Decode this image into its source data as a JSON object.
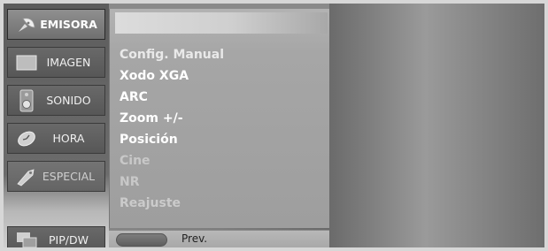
{
  "sidebar": {
    "items": [
      {
        "label": "EMISORA",
        "icon": "satellite-dish-icon"
      },
      {
        "label": "IMAGEN",
        "icon": "picture-icon"
      },
      {
        "label": "SONIDO",
        "icon": "speaker-icon"
      },
      {
        "label": "HORA",
        "icon": "clock-icon"
      },
      {
        "label": "ESPECIAL",
        "icon": "tag-icon"
      },
      {
        "label": "PIP/DW",
        "icon": "pip-icon"
      }
    ]
  },
  "menu": {
    "items": [
      "Config. Manual",
      "Xodo XGA",
      "ARC",
      "Zoom +/-",
      "Posición",
      "Cine",
      "NR",
      "Reajuste"
    ]
  },
  "footer": {
    "prev_label": "Prev."
  }
}
